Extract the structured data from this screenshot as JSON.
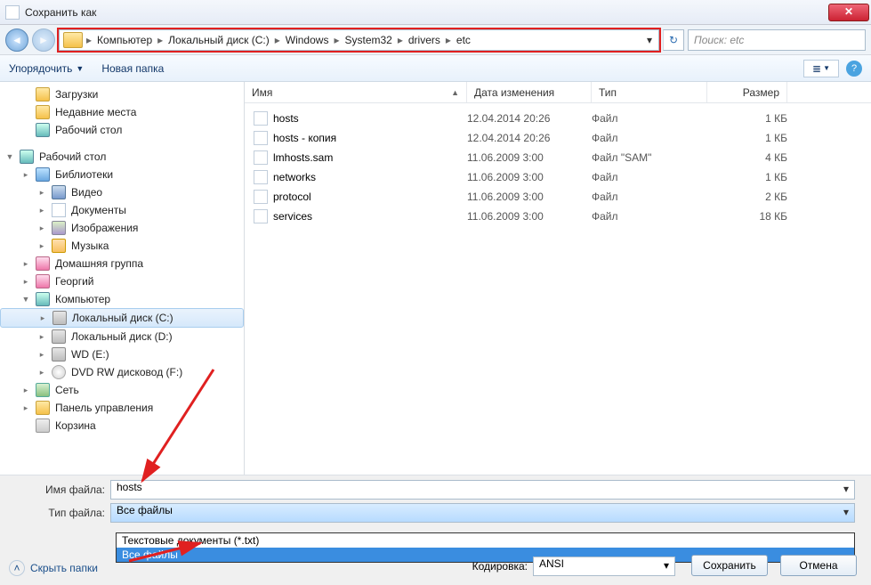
{
  "window": {
    "title": "Сохранить как"
  },
  "breadcrumb": {
    "items": [
      "Компьютер",
      "Локальный диск (C:)",
      "Windows",
      "System32",
      "drivers",
      "etc"
    ]
  },
  "search": {
    "placeholder": "Поиск: etc"
  },
  "toolbar": {
    "organize": "Упорядочить",
    "newfolder": "Новая папка"
  },
  "tree": [
    {
      "indent": 1,
      "exp": "",
      "icon": "folder",
      "label": "Загрузки"
    },
    {
      "indent": 1,
      "exp": "",
      "icon": "folder",
      "label": "Недавние места"
    },
    {
      "indent": 1,
      "exp": "",
      "icon": "computer",
      "label": "Рабочий стол"
    },
    {
      "indent": 0,
      "exp": "",
      "icon": "",
      "label": ""
    },
    {
      "indent": 0,
      "exp": "▼",
      "icon": "computer",
      "label": "Рабочий стол"
    },
    {
      "indent": 1,
      "exp": "▸",
      "icon": "lib",
      "label": "Библиотеки"
    },
    {
      "indent": 2,
      "exp": "▸",
      "icon": "vid",
      "label": "Видео"
    },
    {
      "indent": 2,
      "exp": "▸",
      "icon": "doc",
      "label": "Документы"
    },
    {
      "indent": 2,
      "exp": "▸",
      "icon": "img",
      "label": "Изображения"
    },
    {
      "indent": 2,
      "exp": "▸",
      "icon": "mus",
      "label": "Музыка"
    },
    {
      "indent": 1,
      "exp": "▸",
      "icon": "user",
      "label": "Домашняя группа"
    },
    {
      "indent": 1,
      "exp": "▸",
      "icon": "user",
      "label": "Георгий"
    },
    {
      "indent": 1,
      "exp": "▼",
      "icon": "computer",
      "label": "Компьютер"
    },
    {
      "indent": 2,
      "exp": "▸",
      "icon": "drive",
      "label": "Локальный диск (C:)",
      "sel": true
    },
    {
      "indent": 2,
      "exp": "▸",
      "icon": "drive",
      "label": "Локальный диск (D:)"
    },
    {
      "indent": 2,
      "exp": "▸",
      "icon": "drive",
      "label": "WD (E:)"
    },
    {
      "indent": 2,
      "exp": "▸",
      "icon": "cd",
      "label": "DVD RW дисковод (F:)"
    },
    {
      "indent": 1,
      "exp": "▸",
      "icon": "net",
      "label": "Сеть"
    },
    {
      "indent": 1,
      "exp": "▸",
      "icon": "folder",
      "label": "Панель управления"
    },
    {
      "indent": 1,
      "exp": "",
      "icon": "trash",
      "label": "Корзина"
    }
  ],
  "columns": {
    "name": "Имя",
    "date": "Дата изменения",
    "type": "Тип",
    "size": "Размер"
  },
  "files": [
    {
      "name": "hosts",
      "date": "12.04.2014 20:26",
      "type": "Файл",
      "size": "1 КБ"
    },
    {
      "name": "hosts - копия",
      "date": "12.04.2014 20:26",
      "type": "Файл",
      "size": "1 КБ"
    },
    {
      "name": "lmhosts.sam",
      "date": "11.06.2009 3:00",
      "type": "Файл \"SAM\"",
      "size": "4 КБ"
    },
    {
      "name": "networks",
      "date": "11.06.2009 3:00",
      "type": "Файл",
      "size": "1 КБ"
    },
    {
      "name": "protocol",
      "date": "11.06.2009 3:00",
      "type": "Файл",
      "size": "2 КБ"
    },
    {
      "name": "services",
      "date": "11.06.2009 3:00",
      "type": "Файл",
      "size": "18 КБ"
    }
  ],
  "form": {
    "filename_label": "Имя файла:",
    "filename_value": "hosts",
    "filetype_label": "Тип файла:",
    "filetype_value": "Все файлы",
    "options": [
      "Текстовые документы (*.txt)",
      "Все файлы"
    ],
    "encoding_label": "Кодировка:",
    "encoding_value": "ANSI",
    "save": "Сохранить",
    "cancel": "Отмена",
    "hide": "Скрыть папки"
  }
}
